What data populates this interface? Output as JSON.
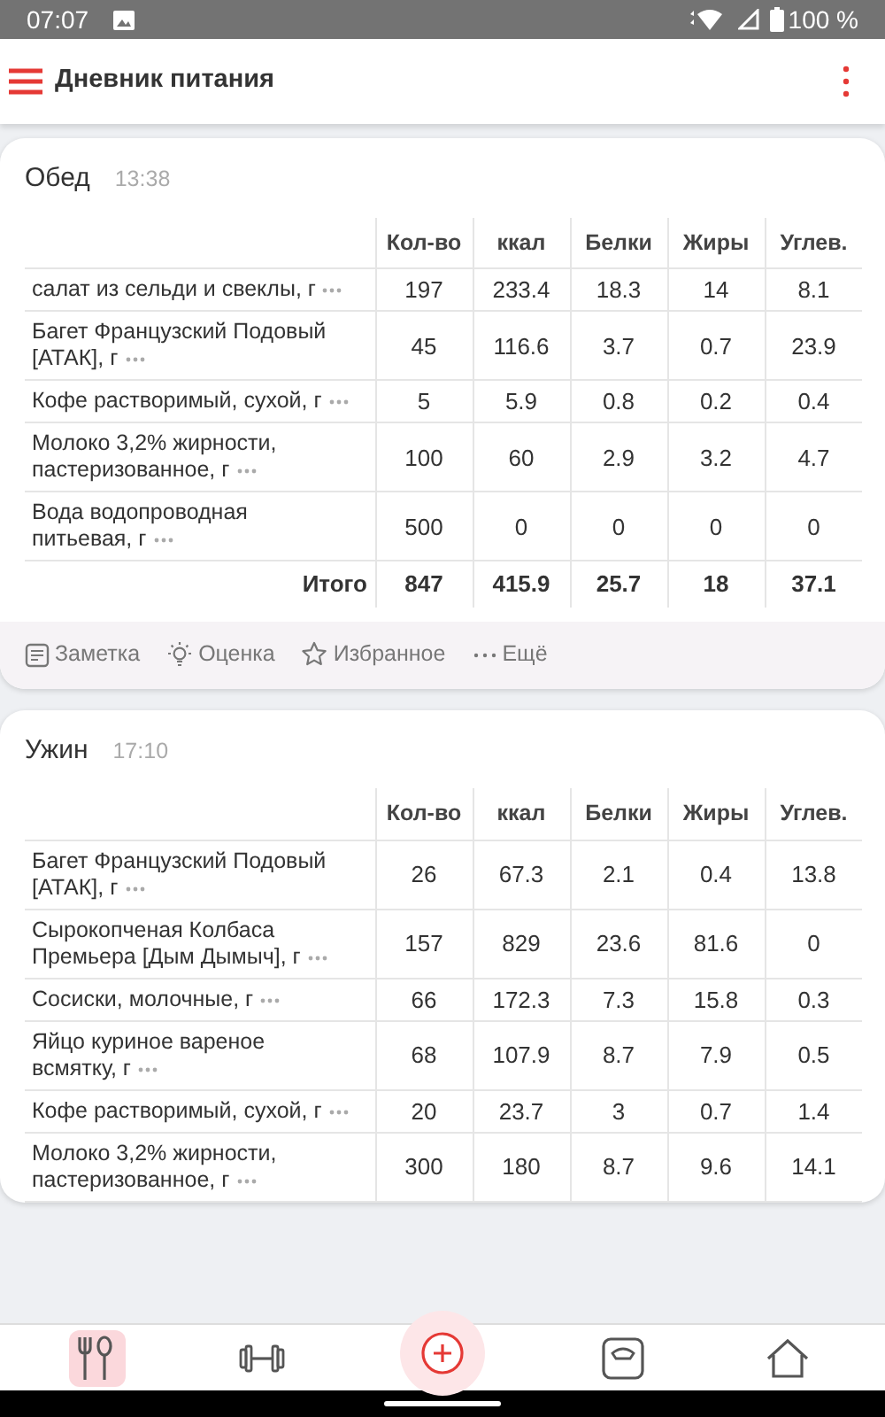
{
  "status_bar": {
    "time": "07:07",
    "battery": "100 %"
  },
  "app_bar": {
    "title": "Дневник питания"
  },
  "meals": [
    {
      "name": "Обед",
      "time": "13:38",
      "columns": [
        "Кол-во",
        "ккал",
        "Белки",
        "Жиры",
        "Углев."
      ],
      "rows": [
        {
          "name": "салат из сельди и свеклы, г",
          "values": [
            "197",
            "233.4",
            "18.3",
            "14",
            "8.1"
          ]
        },
        {
          "name": "Багет Французский Подовый [АТАК], г",
          "values": [
            "45",
            "116.6",
            "3.7",
            "0.7",
            "23.9"
          ]
        },
        {
          "name": "Кофе растворимый, сухой, г",
          "values": [
            "5",
            "5.9",
            "0.8",
            "0.2",
            "0.4"
          ]
        },
        {
          "name": "Молоко 3,2% жирности, пастеризованное, г",
          "values": [
            "100",
            "60",
            "2.9",
            "3.2",
            "4.7"
          ]
        },
        {
          "name": "Вода водопроводная питьевая, г",
          "values": [
            "500",
            "0",
            "0",
            "0",
            "0"
          ]
        }
      ],
      "total": {
        "label": "Итого",
        "values": [
          "847",
          "415.9",
          "25.7",
          "18",
          "37.1"
        ]
      },
      "actions": [
        {
          "kind": "note",
          "label": "Заметка"
        },
        {
          "kind": "rating",
          "label": "Оценка"
        },
        {
          "kind": "favorite",
          "label": "Избранное"
        },
        {
          "kind": "more",
          "label": "Ещё"
        }
      ]
    },
    {
      "name": "Ужин",
      "time": "17:10",
      "columns": [
        "Кол-во",
        "ккал",
        "Белки",
        "Жиры",
        "Углев."
      ],
      "rows": [
        {
          "name": "Багет Французский Подовый [АТАК], г",
          "values": [
            "26",
            "67.3",
            "2.1",
            "0.4",
            "13.8"
          ]
        },
        {
          "name": "Сырокопченая Колбаса Премьера [Дым Дымыч], г",
          "values": [
            "157",
            "829",
            "23.6",
            "81.6",
            "0"
          ]
        },
        {
          "name": "Сосиски, молочные, г",
          "values": [
            "66",
            "172.3",
            "7.3",
            "15.8",
            "0.3"
          ]
        },
        {
          "name": "Яйцо куриное вареное всмятку, г",
          "values": [
            "68",
            "107.9",
            "8.7",
            "7.9",
            "0.5"
          ]
        },
        {
          "name": "Кофе растворимый, сухой, г",
          "values": [
            "20",
            "23.7",
            "3",
            "0.7",
            "1.4"
          ]
        },
        {
          "name": "Молоко 3,2% жирности, пастеризованное, г",
          "values": [
            "300",
            "180",
            "8.7",
            "9.6",
            "14.1"
          ]
        }
      ]
    }
  ],
  "bottom_nav": [
    {
      "kind": "diary",
      "selected": true
    },
    {
      "kind": "exercise",
      "selected": false
    },
    {
      "kind": "add",
      "selected": false
    },
    {
      "kind": "weight",
      "selected": false
    },
    {
      "kind": "home",
      "selected": false
    }
  ]
}
